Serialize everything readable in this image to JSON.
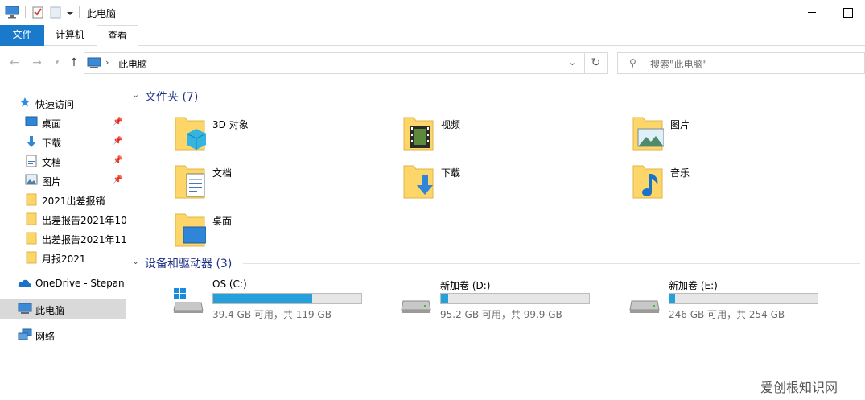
{
  "window": {
    "title": "此电脑"
  },
  "ribbon": {
    "tabs": [
      "文件",
      "计算机",
      "查看"
    ]
  },
  "address": {
    "crumb": "此电脑"
  },
  "search": {
    "placeholder": "搜索\"此电脑\""
  },
  "sidebar": {
    "items": [
      {
        "label": "快速访问",
        "icon": "star-icon"
      },
      {
        "label": "桌面",
        "icon": "desktop-icon",
        "pinned": true
      },
      {
        "label": "下载",
        "icon": "download-icon",
        "pinned": true
      },
      {
        "label": "文档",
        "icon": "document-icon",
        "pinned": true
      },
      {
        "label": "图片",
        "icon": "picture-icon",
        "pinned": true
      },
      {
        "label": "2021出差报销",
        "icon": "folder-icon"
      },
      {
        "label": "出差报告2021年10",
        "icon": "folder-icon"
      },
      {
        "label": "出差报告2021年11",
        "icon": "folder-icon"
      },
      {
        "label": "月报2021",
        "icon": "folder-icon"
      },
      {
        "label": "OneDrive - Stepan",
        "icon": "onedrive-icon"
      },
      {
        "label": "此电脑",
        "icon": "this-pc-icon",
        "selected": true
      },
      {
        "label": "网络",
        "icon": "network-icon"
      }
    ]
  },
  "folders_section": {
    "title": "文件夹 (7)"
  },
  "folders": [
    {
      "label": "3D 对象",
      "icon": "3d-objects-icon"
    },
    {
      "label": "视频",
      "icon": "videos-icon"
    },
    {
      "label": "图片",
      "icon": "pictures-icon"
    },
    {
      "label": "文档",
      "icon": "documents-icon"
    },
    {
      "label": "下载",
      "icon": "downloads-icon"
    },
    {
      "label": "音乐",
      "icon": "music-icon"
    },
    {
      "label": "桌面",
      "icon": "desktop-folder-icon"
    }
  ],
  "drives_section": {
    "title": "设备和驱动器 (3)"
  },
  "drives": [
    {
      "label": "OS (C:)",
      "capacity": "39.4 GB 可用，共 119 GB",
      "used_fraction": 0.669
    },
    {
      "label": "新加卷 (D:)",
      "capacity": "95.2 GB 可用，共 99.9 GB",
      "used_fraction": 0.047
    },
    {
      "label": "新加卷 (E:)",
      "capacity": "246 GB 可用，共 254 GB",
      "used_fraction": 0.031
    }
  ],
  "watermark": "爱创根知识网",
  "colors": {
    "accent": "#1979ca",
    "section": "#1e3287",
    "drive_bar": "#26a0da"
  }
}
